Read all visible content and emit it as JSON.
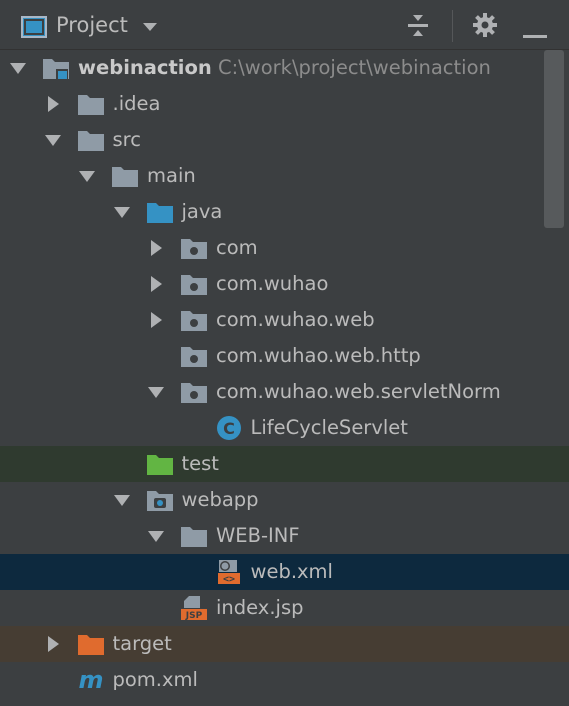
{
  "header": {
    "title": "Project",
    "icons": [
      "project-view-icon",
      "chevron-down-icon",
      "collapse-all-icon",
      "gear-icon",
      "minimize-icon"
    ]
  },
  "tree": [
    {
      "id": "root",
      "label": "webinaction",
      "path": "C:\\work\\project\\webinaction",
      "icon": "module-folder-icon",
      "expanded": true
    },
    {
      "id": "idea",
      "label": ".idea",
      "icon": "folder-icon",
      "expanded": false
    },
    {
      "id": "src",
      "label": "src",
      "icon": "folder-icon",
      "expanded": true
    },
    {
      "id": "main",
      "label": "main",
      "icon": "folder-icon",
      "expanded": true
    },
    {
      "id": "java",
      "label": "java",
      "icon": "source-folder-icon",
      "expanded": true
    },
    {
      "id": "com",
      "label": "com",
      "icon": "package-icon",
      "expanded": false
    },
    {
      "id": "com-wuhao",
      "label": "com.wuhao",
      "icon": "package-icon",
      "expanded": false
    },
    {
      "id": "com-wuhao-web",
      "label": "com.wuhao.web",
      "icon": "package-icon",
      "expanded": false
    },
    {
      "id": "com-wuhao-web-http",
      "label": "com.wuhao.web.http",
      "icon": "package-icon",
      "expanded": null
    },
    {
      "id": "com-wuhao-web-servletnorm",
      "label": "com.wuhao.web.servletNorm",
      "icon": "package-icon",
      "expanded": true
    },
    {
      "id": "lifecycleservlet",
      "label": "LifeCycleServlet",
      "icon": "java-class-icon",
      "expanded": null
    },
    {
      "id": "test",
      "label": "test",
      "icon": "test-folder-icon",
      "expanded": null,
      "highlight": "green"
    },
    {
      "id": "webapp",
      "label": "webapp",
      "icon": "web-folder-icon",
      "expanded": true
    },
    {
      "id": "web-inf",
      "label": "WEB-INF",
      "icon": "folder-icon",
      "expanded": true
    },
    {
      "id": "web-xml",
      "label": "web.xml",
      "icon": "xml-file-icon",
      "expanded": null,
      "highlight": "blue"
    },
    {
      "id": "index-jsp",
      "label": "index.jsp",
      "icon": "jsp-file-icon",
      "expanded": null
    },
    {
      "id": "target",
      "label": "target",
      "icon": "excluded-folder-icon",
      "expanded": false,
      "highlight": "brown"
    },
    {
      "id": "pom-xml",
      "label": "pom.xml",
      "icon": "maven-icon",
      "expanded": null
    }
  ],
  "colors": {
    "background": "#3c3f41",
    "selected": "#0d293e",
    "text": "#bbbbbb",
    "source_folder": "#3592c4",
    "test_folder": "#62b543",
    "excluded_folder": "#e06b2e"
  }
}
